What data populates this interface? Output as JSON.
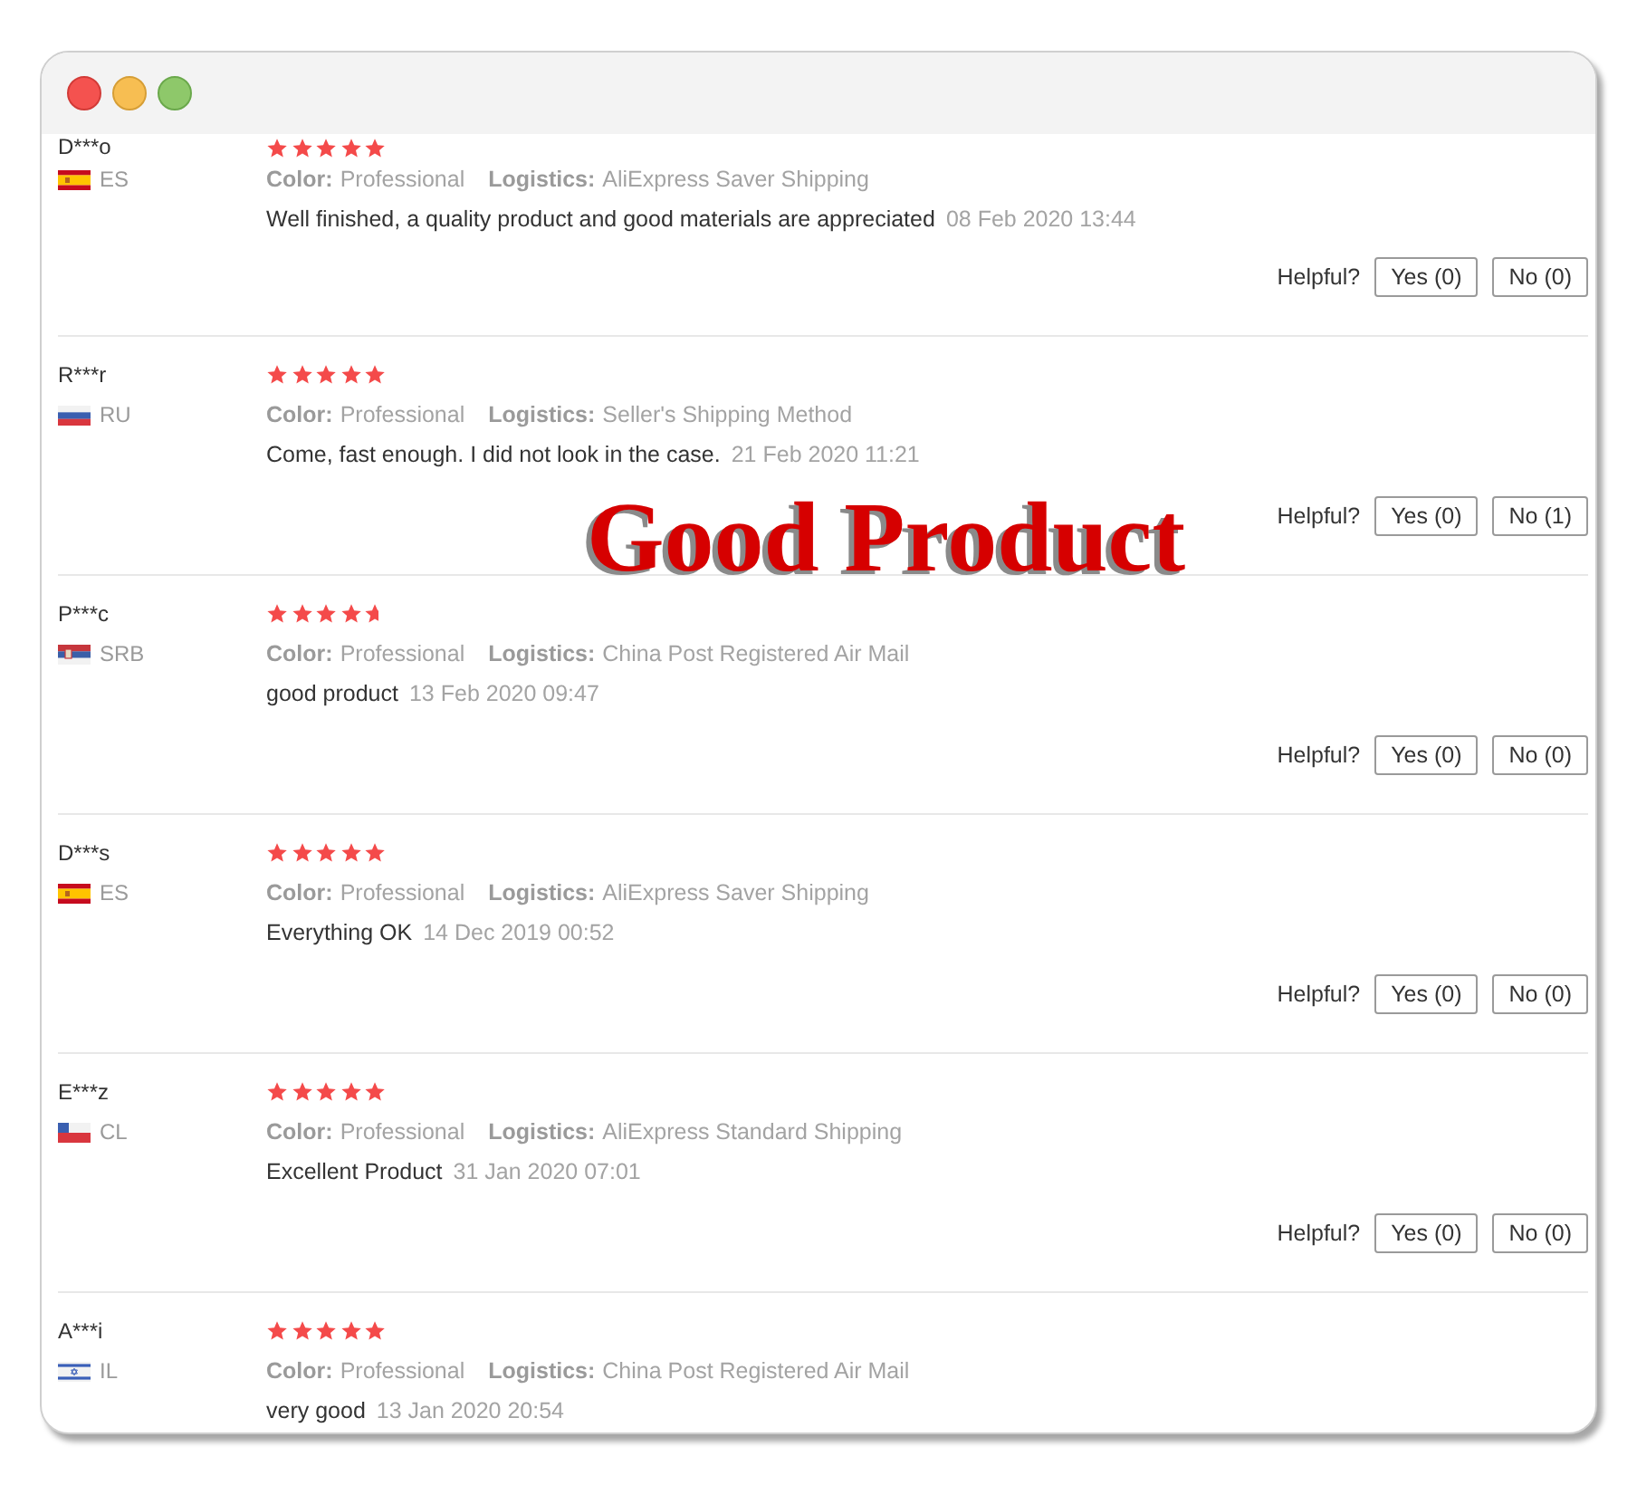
{
  "window": {
    "controls": [
      {
        "kind": "close",
        "color": "#f4524f"
      },
      {
        "kind": "minimize",
        "color": "#f7be52"
      },
      {
        "kind": "zoom",
        "color": "#8ec86a"
      }
    ]
  },
  "overlay_title": "Good Product",
  "reviews": [
    {
      "name": "D***o",
      "flag": {
        "kind": "spain"
      },
      "country": "ES",
      "stars": 5,
      "color": {
        "label": "Color:",
        "value": "Professional"
      },
      "logistics": {
        "label": "Logistics:",
        "value": "AliExpress Saver Shipping"
      },
      "comment": "Well finished, a quality product and good materials are appreciated",
      "date": "08 Feb 2020 13:44",
      "helpful": {
        "label": "Helpful?",
        "yes": "Yes (0)",
        "no": "No (0)"
      }
    },
    {
      "name": "R***r",
      "flag": {
        "kind": "russia"
      },
      "country": "RU",
      "stars": 5,
      "color": {
        "label": "Color:",
        "value": "Professional"
      },
      "logistics": {
        "label": "Logistics:",
        "value": "Seller's Shipping Method"
      },
      "comment": "Come, fast enough. I did not look in the case.",
      "date": "21 Feb 2020 11:21",
      "helpful": {
        "label": "Helpful?",
        "yes": "Yes (0)",
        "no": "No (1)"
      }
    },
    {
      "name": "P***c",
      "flag": {
        "kind": "serbia"
      },
      "country": "SRB",
      "stars": 4.7,
      "color": {
        "label": "Color:",
        "value": "Professional"
      },
      "logistics": {
        "label": "Logistics:",
        "value": "China Post Registered Air Mail"
      },
      "comment": "good product",
      "date": "13 Feb 2020 09:47",
      "helpful": {
        "label": "Helpful?",
        "yes": "Yes (0)",
        "no": "No (0)"
      }
    },
    {
      "name": "D***s",
      "flag": {
        "kind": "spain"
      },
      "country": "ES",
      "stars": 5,
      "color": {
        "label": "Color:",
        "value": "Professional"
      },
      "logistics": {
        "label": "Logistics:",
        "value": "AliExpress Saver Shipping"
      },
      "comment": "Everything OK",
      "date": "14 Dec 2019 00:52",
      "helpful": {
        "label": "Helpful?",
        "yes": "Yes (0)",
        "no": "No (0)"
      }
    },
    {
      "name": "E***z",
      "flag": {
        "kind": "chile"
      },
      "country": "CL",
      "stars": 5,
      "color": {
        "label": "Color:",
        "value": "Professional"
      },
      "logistics": {
        "label": "Logistics:",
        "value": "AliExpress Standard Shipping"
      },
      "comment": "Excellent Product",
      "date": "31 Jan 2020 07:01",
      "helpful": {
        "label": "Helpful?",
        "yes": "Yes (0)",
        "no": "No (0)"
      }
    },
    {
      "name": "A***i",
      "flag": {
        "kind": "israel"
      },
      "country": "IL",
      "stars": 5,
      "color": {
        "label": "Color:",
        "value": "Professional"
      },
      "logistics": {
        "label": "Logistics:",
        "value": "China Post Registered Air Mail"
      },
      "comment": "very good",
      "date": "13 Jan 2020 20:54"
    }
  ]
}
